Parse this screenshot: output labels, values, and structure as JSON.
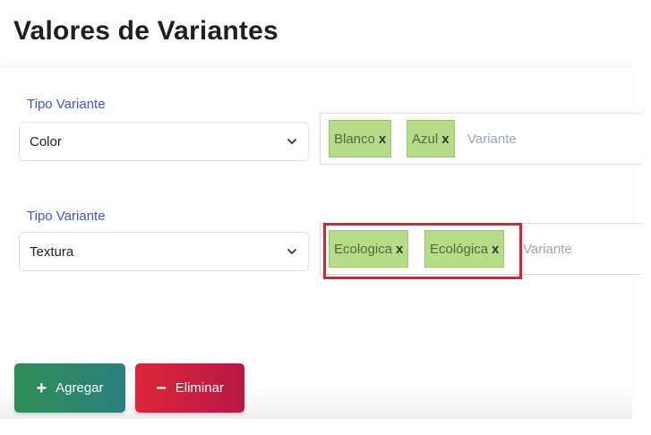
{
  "page": {
    "title": "Valores de Variantes"
  },
  "rows": [
    {
      "label": "Tipo Variante",
      "selected": "Color",
      "tags": [
        "Blanco",
        "Azul"
      ],
      "placeholder": "Variante"
    },
    {
      "label": "Tipo Variante",
      "selected": "Textura",
      "tags": [
        "Ecologica",
        "Ecológica"
      ],
      "placeholder": "Variante"
    }
  ],
  "tag_remove_glyph": "x",
  "buttons": {
    "add_label": "Agregar",
    "add_glyph": "+",
    "delete_label": "Eliminar",
    "delete_glyph": "−"
  },
  "colors": {
    "label": "#3b55e6",
    "tag_bg": "#b6dc8a",
    "highlight": "#e0202a",
    "add_button": "#2f8e54",
    "delete_button": "#dc2638"
  },
  "icons": {
    "select_arrow": "chevron-down-icon",
    "add": "plus-icon",
    "delete": "minus-icon"
  }
}
